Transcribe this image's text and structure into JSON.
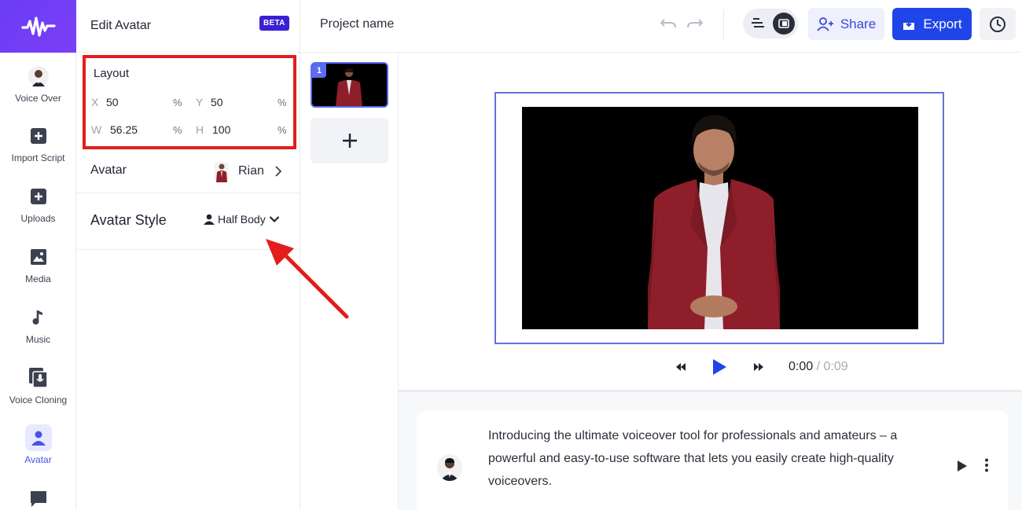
{
  "rail": {
    "items": [
      {
        "label": "Voice Over",
        "icon": "avatar-photo-icon"
      },
      {
        "label": "Import Script",
        "icon": "plus-square-icon"
      },
      {
        "label": "Uploads",
        "icon": "plus-square-icon"
      },
      {
        "label": "Media",
        "icon": "image-icon"
      },
      {
        "label": "Music",
        "icon": "music-note-icon"
      },
      {
        "label": "Voice Cloning",
        "icon": "voice-cloning-icon"
      },
      {
        "label": "Avatar",
        "icon": "person-icon",
        "active": true
      },
      {
        "label": "",
        "icon": "chat-icon"
      }
    ]
  },
  "panel": {
    "title": "Edit Avatar",
    "badge": "BETA",
    "layout": {
      "title": "Layout",
      "x_label": "X",
      "x_value": "50",
      "x_unit": "%",
      "y_label": "Y",
      "y_value": "50",
      "y_unit": "%",
      "w_label": "W",
      "w_value": "56.25",
      "w_unit": "%",
      "h_label": "H",
      "h_value": "100",
      "h_unit": "%"
    },
    "avatar": {
      "label": "Avatar",
      "name": "Rian"
    },
    "avatar_style": {
      "label": "Avatar Style",
      "value": "Half Body"
    }
  },
  "topbar": {
    "project_name": "Project name",
    "share_label": "Share",
    "export_label": "Export"
  },
  "slides": [
    {
      "number": "1"
    }
  ],
  "player": {
    "current": "0:00",
    "separator": " / ",
    "total": "0:09"
  },
  "script": {
    "text": "Introducing the ultimate voiceover tool for professionals and amateurs – a powerful and easy-to-use software that lets you easily create high-quality voiceovers."
  },
  "colors": {
    "brand": "#6a3cf5",
    "primary": "#1f45e8",
    "annotation": "#e31d1d",
    "canvas_border": "#6573d6"
  }
}
